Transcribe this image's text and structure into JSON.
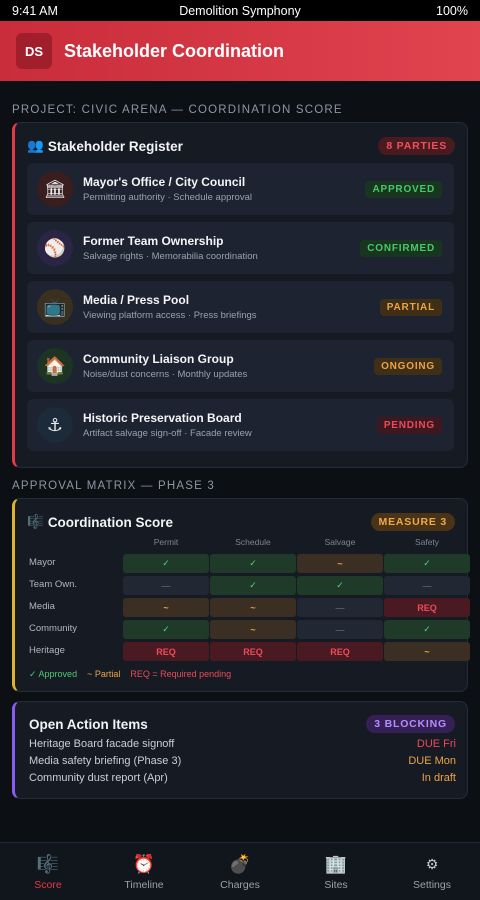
{
  "status": {
    "time": "9:41 AM",
    "title": "Demolition Symphony",
    "battery": "100%"
  },
  "header": {
    "logo": "DS",
    "title": "Stakeholder Coordination"
  },
  "section1": {
    "label": "PROJECT: CIVIC ARENA — COORDINATION SCORE"
  },
  "register": {
    "icon": "👥",
    "title": "Stakeholder Register",
    "count": "8 PARTIES",
    "items": [
      {
        "icon": "🏛",
        "name": "Mayor's Office / City Council",
        "sub": "Permitting authority · Schedule approval",
        "status": "APPROVED",
        "tone": "green",
        "icon_bg": "#3a1d1d"
      },
      {
        "icon": "⚾",
        "name": "Former Team Ownership",
        "sub": "Salvage rights · Memorabilia coordination",
        "status": "CONFIRMED",
        "tone": "green",
        "icon_bg": "#2a2545"
      },
      {
        "icon": "📺",
        "name": "Media / Press Pool",
        "sub": "Viewing platform access · Press briefings",
        "status": "PARTIAL",
        "tone": "orange",
        "icon_bg": "#3a3020"
      },
      {
        "icon": "🏠",
        "name": "Community Liaison Group",
        "sub": "Noise/dust concerns · Monthly updates",
        "status": "ONGOING",
        "tone": "orange",
        "icon_bg": "#1d3324"
      },
      {
        "icon": "⚓",
        "name": "Historic Preservation Board",
        "sub": "Artifact salvage sign-off · Facade review",
        "status": "PENDING",
        "tone": "red",
        "icon_bg": "#1d2a3a"
      }
    ]
  },
  "section2": {
    "label": "APPROVAL MATRIX — PHASE 3"
  },
  "matrix": {
    "icon": "🎼",
    "title": "Coordination Score",
    "badge": "MEASURE 3",
    "columns": [
      "Permit",
      "Schedule",
      "Salvage",
      "Safety"
    ],
    "rows": [
      {
        "label": "Mayor",
        "cells": [
          {
            "v": "✓",
            "t": "ok"
          },
          {
            "v": "✓",
            "t": "ok"
          },
          {
            "v": "~",
            "t": "partial"
          },
          {
            "v": "✓",
            "t": "ok"
          }
        ]
      },
      {
        "label": "Team Own.",
        "cells": [
          {
            "v": "—",
            "t": "none"
          },
          {
            "v": "✓",
            "t": "ok"
          },
          {
            "v": "✓",
            "t": "ok"
          },
          {
            "v": "—",
            "t": "none"
          }
        ]
      },
      {
        "label": "Media",
        "cells": [
          {
            "v": "~",
            "t": "partial"
          },
          {
            "v": "~",
            "t": "partial"
          },
          {
            "v": "—",
            "t": "none"
          },
          {
            "v": "REQ",
            "t": "req"
          }
        ]
      },
      {
        "label": "Community",
        "cells": [
          {
            "v": "✓",
            "t": "ok"
          },
          {
            "v": "~",
            "t": "partial"
          },
          {
            "v": "—",
            "t": "none"
          },
          {
            "v": "✓",
            "t": "ok"
          }
        ]
      },
      {
        "label": "Heritage",
        "cells": [
          {
            "v": "REQ",
            "t": "req"
          },
          {
            "v": "REQ",
            "t": "req"
          },
          {
            "v": "REQ",
            "t": "req"
          },
          {
            "v": "~",
            "t": "partial"
          }
        ]
      }
    ],
    "legend": {
      "approved": "✓ Approved",
      "partial": "~ Partial",
      "required": "REQ = Required pending"
    }
  },
  "actions": {
    "title": "Open Action Items",
    "badge": "3 BLOCKING",
    "items": [
      {
        "text": "Heritage Board facade signoff",
        "due": "DUE Fri",
        "color": "#ec4a58"
      },
      {
        "text": "Media safety briefing (Phase 3)",
        "due": "DUE Mon",
        "color": "#eaa446"
      },
      {
        "text": "Community dust report (Apr)",
        "due": "In draft",
        "color": "#eaa446"
      }
    ]
  },
  "nav": {
    "items": [
      {
        "icon": "🎼",
        "label": "Score",
        "active": true
      },
      {
        "icon": "⏰",
        "label": "Timeline",
        "active": false
      },
      {
        "icon": "💣",
        "label": "Charges",
        "active": false
      },
      {
        "icon": "🏢",
        "label": "Sites",
        "active": false
      },
      {
        "icon": "⚙",
        "label": "Settings",
        "active": false
      }
    ]
  }
}
